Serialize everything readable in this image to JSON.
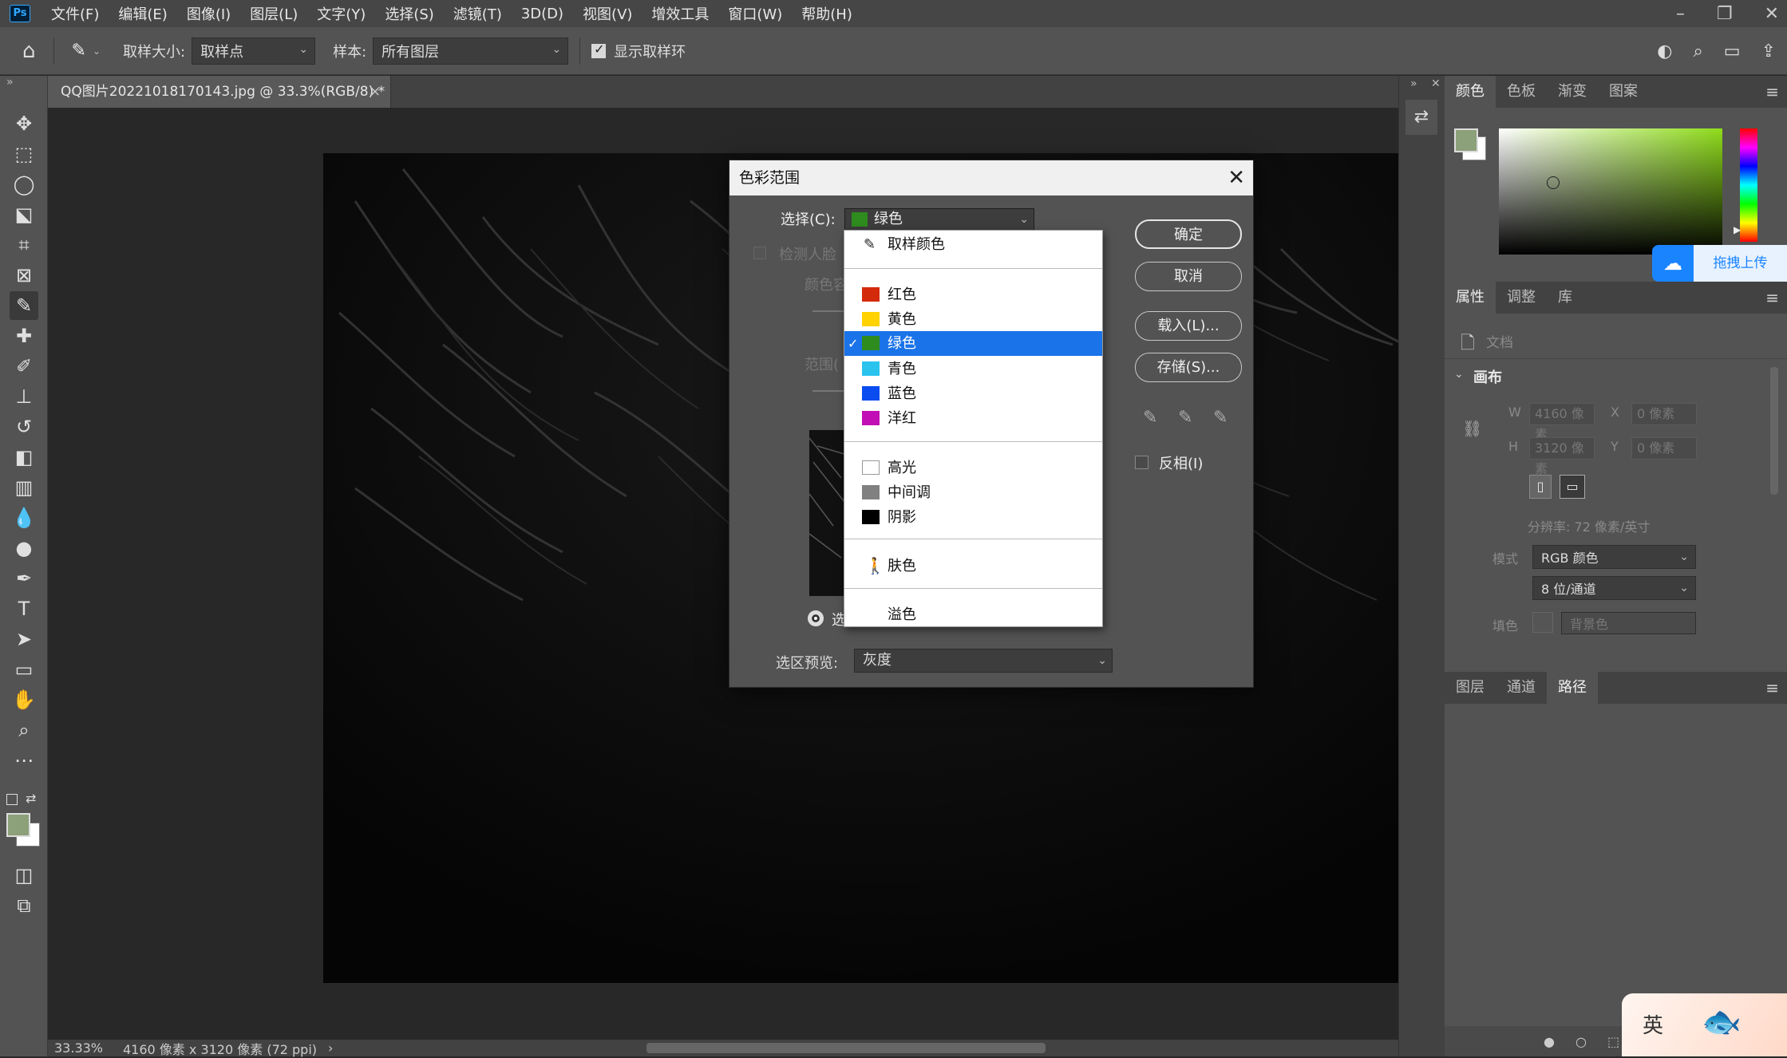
{
  "menubar": {
    "logo": "Ps",
    "items": [
      "文件(F)",
      "编辑(E)",
      "图像(I)",
      "图层(L)",
      "文字(Y)",
      "选择(S)",
      "滤镜(T)",
      "3D(D)",
      "视图(V)",
      "增效工具",
      "窗口(W)",
      "帮助(H)"
    ]
  },
  "options": {
    "sample_size_label": "取样大小:",
    "sample_size_value": "取样点",
    "sample_label": "样本:",
    "sample_value": "所有图层",
    "show_ring_label": "显示取样环",
    "show_ring_checked": true
  },
  "document": {
    "tab_title": "QQ图片20221018170143.jpg @ 33.3%(RGB/8) *",
    "tab_close": "×"
  },
  "status": {
    "zoom": "33.33%",
    "info": "4160 像素 x 3120 像素 (72 ppi)",
    "arrow": "›"
  },
  "dialog": {
    "title": "色彩范围",
    "select_label": "选择(C):",
    "select_value": "绿色",
    "select_swatch": "#2e8b1e",
    "detect_faces_label": "检测人脸",
    "color_tolerance_label": "颜色容",
    "range_label": "范围(",
    "radio_label": "选",
    "ok_label": "确定",
    "cancel_label": "取消",
    "load_label": "载入(L)...",
    "save_label": "存储(S)...",
    "invert_label": "反相(I)",
    "preview_label": "选区预览:",
    "preview_value": "灰度"
  },
  "dropdown": {
    "sample_item": "取样颜色",
    "items": [
      {
        "label": "红色",
        "color": "#d42a0c"
      },
      {
        "label": "黄色",
        "color": "#ffd200"
      },
      {
        "label": "绿色",
        "color": "#2e8b1e",
        "selected": true
      },
      {
        "label": "青色",
        "color": "#29c3ee"
      },
      {
        "label": "蓝色",
        "color": "#0a4cf0"
      },
      {
        "label": "洋红",
        "color": "#c20fb5"
      },
      {
        "label": "高光",
        "color": "#ffffff"
      },
      {
        "label": "中间调",
        "color": "#808080"
      },
      {
        "label": "阴影",
        "color": "#000000"
      },
      {
        "label": "肤色",
        "color": ""
      },
      {
        "label": "溢色",
        "color": ""
      }
    ],
    "checkmark": "✓"
  },
  "color_panel": {
    "tabs": [
      "颜色",
      "色板",
      "渐变",
      "图案"
    ],
    "foreground": "#8ca07a",
    "background": "#ffffff",
    "upload_label": "拖拽上传"
  },
  "properties_panel": {
    "tabs": [
      "属性",
      "调整",
      "库"
    ],
    "doc_label": "文档",
    "canvas_label": "画布",
    "w_label": "W",
    "w_value": "4160 像素",
    "h_label": "H",
    "h_value": "3120 像素",
    "x_label": "X",
    "x_value": "0 像素",
    "y_label": "Y",
    "y_value": "0 像素",
    "resolution": "分辨率: 72 像素/英寸",
    "mode_label": "模式",
    "mode_value": "RGB 颜色",
    "depth_value": "8 位/通道",
    "fill_label": "填色",
    "fill_value": "背景色"
  },
  "layers_panel": {
    "tabs": [
      "图层",
      "通道",
      "路径"
    ]
  },
  "sticker": {
    "text": "英"
  }
}
